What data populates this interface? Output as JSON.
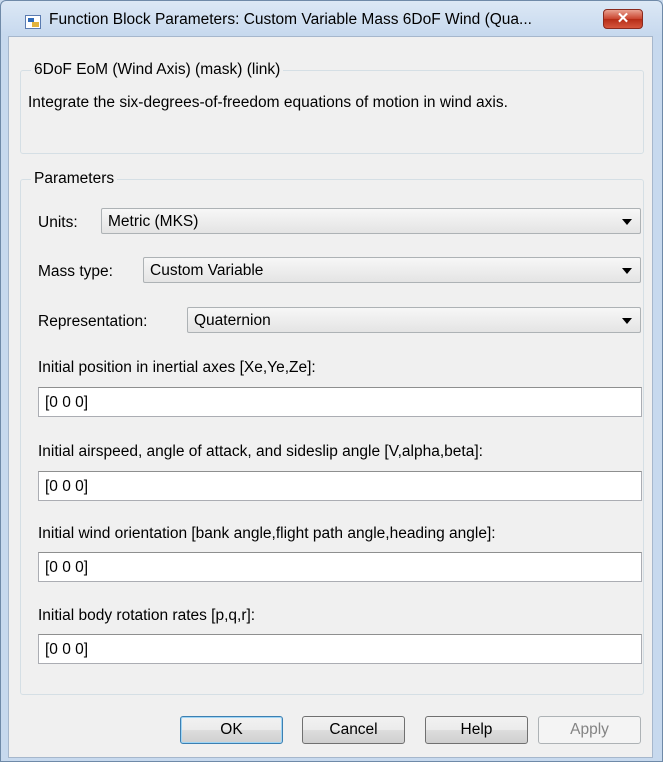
{
  "window": {
    "title": "Function Block Parameters: Custom Variable Mass 6DoF Wind (Qua...",
    "close_label": "✕"
  },
  "block": {
    "heading": "6DoF EoM (Wind Axis) (mask) (link)",
    "description": "Integrate the six-degrees-of-freedom equations of motion in wind axis."
  },
  "parameters": {
    "heading": "Parameters",
    "units": {
      "label": "Units:",
      "value": "Metric (MKS)"
    },
    "mass_type": {
      "label": "Mass type:",
      "value": "Custom Variable"
    },
    "representation": {
      "label": "Representation:",
      "value": "Quaternion"
    },
    "initial_position": {
      "label": "Initial position in inertial axes [Xe,Ye,Ze]:",
      "value": "[0 0 0]"
    },
    "initial_airspeed": {
      "label": "Initial airspeed, angle of attack, and sideslip angle [V,alpha,beta]:",
      "value": "[0 0 0]"
    },
    "initial_wind_orientation": {
      "label": "Initial wind orientation [bank angle,flight path angle,heading angle]:",
      "value": "[0 0 0]"
    },
    "initial_body_rates": {
      "label": "Initial body rotation rates [p,q,r]:",
      "value": "[0 0 0]"
    }
  },
  "buttons": {
    "ok": "OK",
    "cancel": "Cancel",
    "help": "Help",
    "apply": "Apply"
  },
  "icons": {
    "app": "simulink-block-icon",
    "close": "close-icon",
    "dropdown": "chevron-down-icon"
  }
}
